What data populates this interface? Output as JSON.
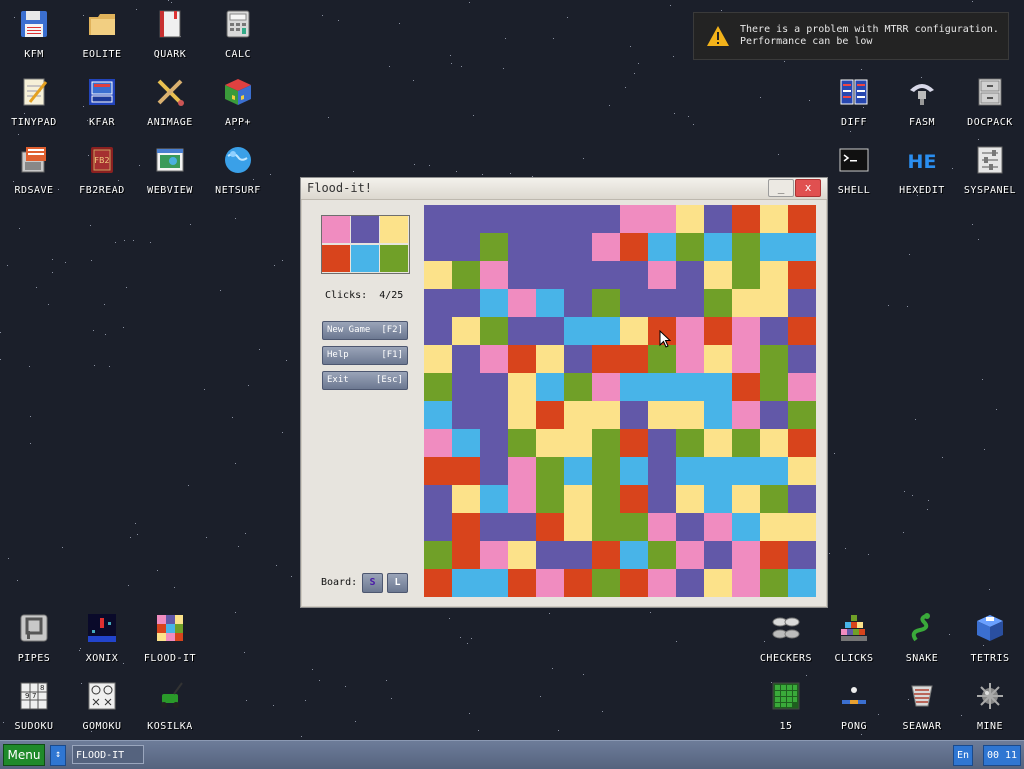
{
  "desktop": {
    "icons": [
      {
        "label": "KFM",
        "icon": "floppy-disk-icon"
      },
      {
        "label": "EOLITE",
        "icon": "folder-icon"
      },
      {
        "label": "QUARK",
        "icon": "notebook-icon"
      },
      {
        "label": "CALC",
        "icon": "calculator-icon"
      },
      {
        "label": "TINYPAD",
        "icon": "notepad-icon"
      },
      {
        "label": "KFAR",
        "icon": "archive-icon"
      },
      {
        "label": "ANIMAGE",
        "icon": "paint-tools-icon"
      },
      {
        "label": "APP+",
        "icon": "rubik-cube-icon"
      },
      {
        "label": "RDSAVE",
        "icon": "save-image-icon"
      },
      {
        "label": "FB2READ",
        "icon": "book-icon"
      },
      {
        "label": "WEBVIEW",
        "icon": "web-page-icon"
      },
      {
        "label": "NETSURF",
        "icon": "globe-icon"
      },
      {
        "label": "DIFF",
        "icon": "diff-icon"
      },
      {
        "label": "FASM",
        "icon": "assembler-icon"
      },
      {
        "label": "DOCPACK",
        "icon": "drawer-icon"
      },
      {
        "label": "SHELL",
        "icon": "terminal-icon"
      },
      {
        "label": "HEXEDIT",
        "icon": "hex-editor-icon"
      },
      {
        "label": "SYSPANEL",
        "icon": "sliders-icon"
      },
      {
        "label": "PIPES",
        "icon": "pipes-icon"
      },
      {
        "label": "XONIX",
        "icon": "xonix-icon"
      },
      {
        "label": "FLOOD-IT",
        "icon": "color-grid-icon"
      },
      {
        "label": "SUDOKU",
        "icon": "sudoku-icon"
      },
      {
        "label": "GOMOKU",
        "icon": "gomoku-icon"
      },
      {
        "label": "KOSILKA",
        "icon": "lawnmower-icon"
      },
      {
        "label": "CHECKERS",
        "icon": "checkers-icon"
      },
      {
        "label": "CLICKS",
        "icon": "clicks-icon"
      },
      {
        "label": "SNAKE",
        "icon": "snake-icon"
      },
      {
        "label": "TETRIS",
        "icon": "tetris-icon"
      },
      {
        "label": "15",
        "icon": "fifteen-puzzle-icon"
      },
      {
        "label": "PONG",
        "icon": "pong-icon"
      },
      {
        "label": "SEAWAR",
        "icon": "seawar-icon"
      },
      {
        "label": "MINE",
        "icon": "mine-icon"
      }
    ]
  },
  "notification": {
    "icon": "warning-icon",
    "text": "There is a problem with MTRR configuration.\nPerformance can be low"
  },
  "window": {
    "title": "Flood-it!",
    "minimize_label": "_",
    "close_label": "x"
  },
  "game": {
    "palette_order": [
      "pink",
      "purple",
      "yellow",
      "red",
      "blue",
      "green"
    ],
    "colors": {
      "pink": "#f08cc0",
      "purple": "#6258a8",
      "yellow": "#fce28a",
      "red": "#d8441c",
      "blue": "#48b4e8",
      "green": "#70a028"
    },
    "clicks_label": "Clicks:",
    "clicks_value": "4/25",
    "new_game_label": "New Game",
    "new_game_key": "[F2]",
    "help_label": "Help",
    "help_key": "[F1]",
    "exit_label": "Exit",
    "exit_key": "[Esc]",
    "board_label": "Board:",
    "size_small_label": "S",
    "size_large_label": "L",
    "board_size": 14,
    "board": [
      "UUUUUUUPPYURYR",
      "UUGUUUPRBGBGBB",
      "YGPUUUUUPUYGYR",
      "UUBPBUGUUUGYYU",
      "UYGUUBBYRPRPUR",
      "YUPRYURRGPYPGU",
      "GUUYBGPBBBBRGP",
      "BUUYRYYUYYBPUG",
      "PBUGYYGRUGYGYR",
      "RRUPGBGBUBBBBY",
      "UYBPGYGRUYBYGU",
      "URUURYGGPUPBYY",
      "GRPYUURBGPUPRU",
      "RBBRPRGRPUYPGB"
    ]
  },
  "taskbar": {
    "menu_label": "Menu",
    "switch_label": "↕",
    "running_app": "FLOOD-IT",
    "language": "En",
    "time": "00 11"
  }
}
